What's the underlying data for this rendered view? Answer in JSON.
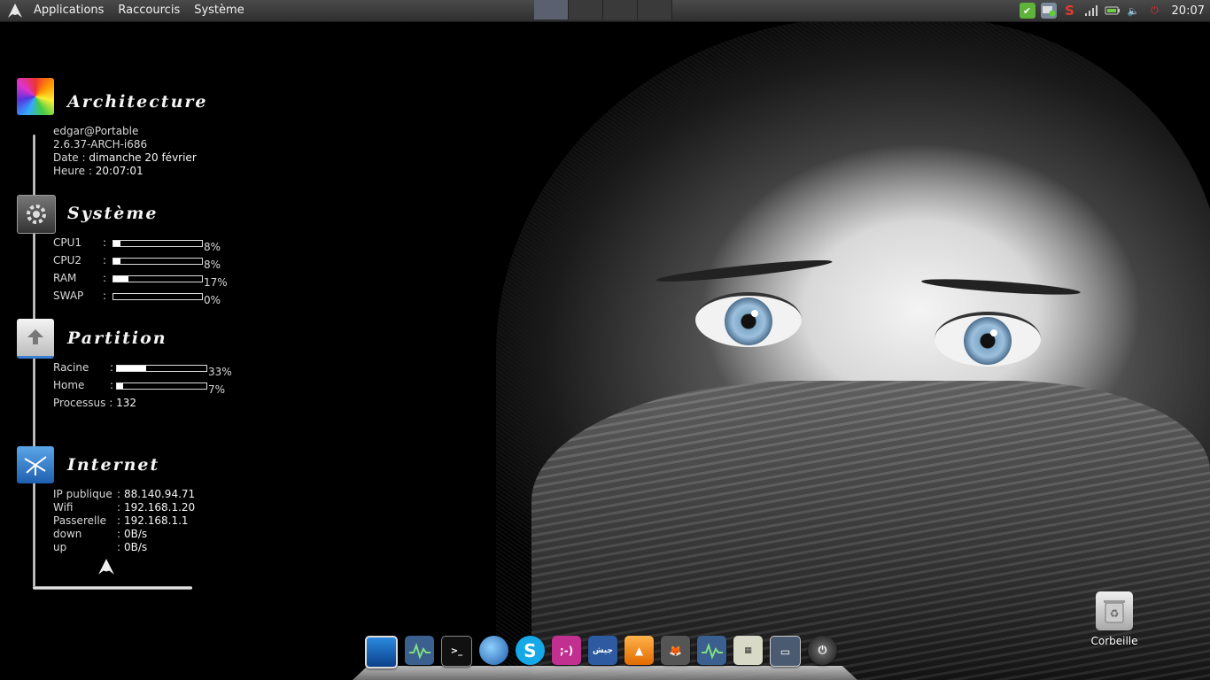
{
  "top_panel": {
    "menus": [
      "Applications",
      "Raccourcis",
      "Système"
    ],
    "clock": "20:07",
    "workspaces": 4,
    "active_workspace": 1,
    "tray_icons": [
      "checkmark-icon",
      "network-icon",
      "update-icon",
      "signal-icon",
      "battery-icon",
      "volume-icon",
      "power-icon"
    ]
  },
  "conky": {
    "architecture": {
      "title": "Architecture",
      "user_host": "edgar@Portable",
      "kernel": "2.6.37-ARCH-i686",
      "date_label": "Date :",
      "date_value": "dimanche 20 février",
      "time_label": "Heure :",
      "time_value": "20:07:01"
    },
    "systeme": {
      "title": "Système",
      "rows": [
        {
          "label": "CPU1",
          "sep": ":",
          "percent": 8,
          "pct_text": "8%"
        },
        {
          "label": "CPU2",
          "sep": ":",
          "percent": 8,
          "pct_text": "8%"
        },
        {
          "label": "RAM",
          "sep": ":",
          "percent": 17,
          "pct_text": "17%"
        },
        {
          "label": "SWAP",
          "sep": ":",
          "percent": 0,
          "pct_text": "0%"
        }
      ]
    },
    "partition": {
      "title": "Partition",
      "rows": [
        {
          "label": "Racine",
          "sep": ":",
          "percent": 33,
          "pct_text": "33%"
        },
        {
          "label": "Home",
          "sep": ":",
          "percent": 7,
          "pct_text": "7%"
        }
      ],
      "processes_label": "Processus :",
      "processes_value": "132"
    },
    "internet": {
      "title": "Internet",
      "rows": [
        {
          "label": "IP publique",
          "value": "88.140.94.71"
        },
        {
          "label": "Wifi",
          "value": "192.168.1.20"
        },
        {
          "label": "Passerelle",
          "value": "192.168.1.1"
        },
        {
          "label": "down",
          "value": "0B/s"
        },
        {
          "label": "up",
          "value": "0B/s"
        }
      ],
      "sep": ":"
    }
  },
  "dock": {
    "icons": [
      "desktop-icon",
      "monitor-app-icon",
      "terminal-icon",
      "browser-icon",
      "skype-icon",
      "emoticon-chat-icon",
      "arabic-app-icon",
      "vlc-icon",
      "gimp-icon",
      "monitor-app-icon-2",
      "calculator-icon",
      "window-switcher-icon",
      "power-icon"
    ]
  },
  "desktop": {
    "trash_label": "Corbeille"
  },
  "colors": {
    "panel": "#3a3a3a",
    "active_workspace": "#5a6070",
    "text": "#e6e6e6"
  }
}
